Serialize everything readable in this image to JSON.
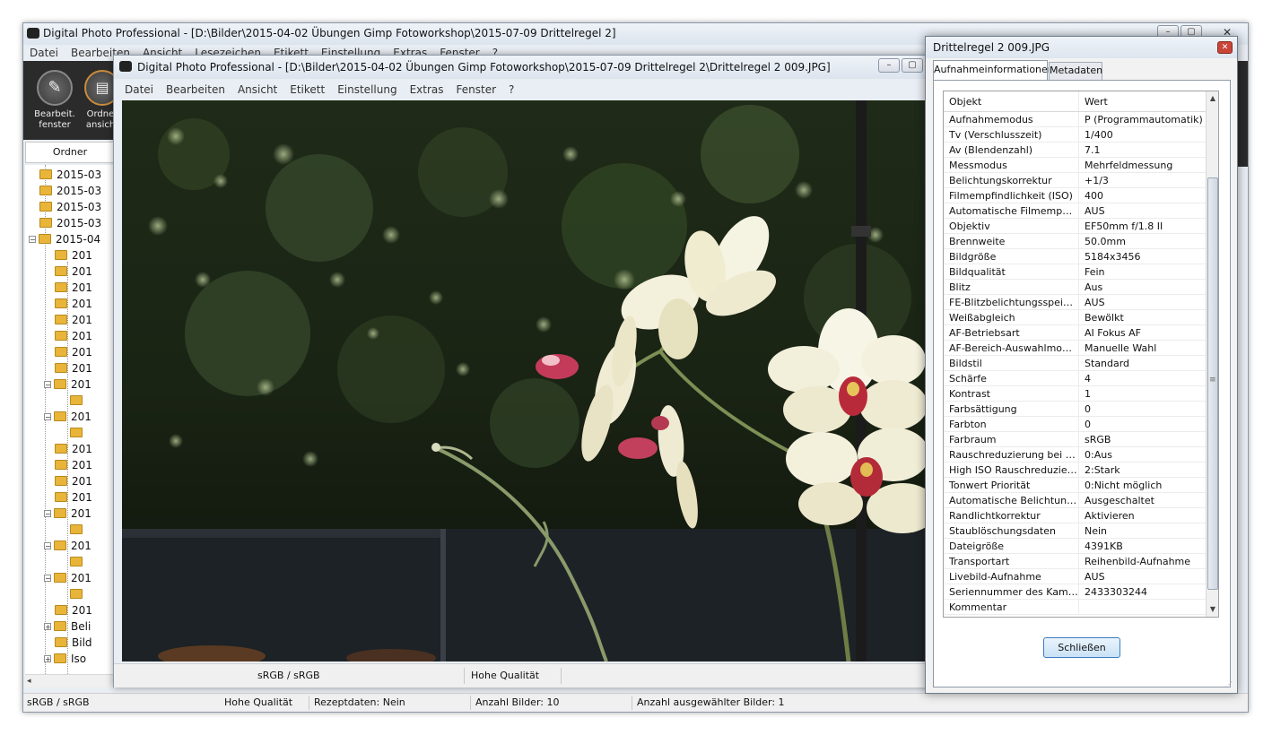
{
  "main_window": {
    "title": "Digital Photo Professional - [D:\\Bilder\\2015-04-02 Übungen  Gimp Fotoworkshop\\2015-07-09 Drittelregel 2]",
    "menu": [
      "Datei",
      "Bearbeiten",
      "Ansicht",
      "Lesezeichen",
      "Etikett",
      "Einstellung",
      "Extras",
      "Fenster",
      "?"
    ],
    "toolbar": [
      {
        "label": "Bearbeit. fenster",
        "icon": "edit-window-icon"
      },
      {
        "label": "Ordner ansicht",
        "icon": "folder-view-icon"
      }
    ],
    "folder_panel_title": "Ordner",
    "tree": [
      {
        "label": "2015-03",
        "indent": 0,
        "expander": ""
      },
      {
        "label": "2015-03",
        "indent": 0,
        "expander": ""
      },
      {
        "label": "2015-03",
        "indent": 0,
        "expander": ""
      },
      {
        "label": "2015-03",
        "indent": 0,
        "expander": ""
      },
      {
        "label": "2015-04",
        "indent": 0,
        "expander": "-"
      },
      {
        "label": "201",
        "indent": 1,
        "expander": ""
      },
      {
        "label": "201",
        "indent": 1,
        "expander": ""
      },
      {
        "label": "201",
        "indent": 1,
        "expander": ""
      },
      {
        "label": "201",
        "indent": 1,
        "expander": ""
      },
      {
        "label": "201",
        "indent": 1,
        "expander": ""
      },
      {
        "label": "201",
        "indent": 1,
        "expander": ""
      },
      {
        "label": "201",
        "indent": 1,
        "expander": ""
      },
      {
        "label": "201",
        "indent": 1,
        "expander": ""
      },
      {
        "label": "201",
        "indent": 1,
        "expander": "-"
      },
      {
        "label": "",
        "indent": 2,
        "expander": ""
      },
      {
        "label": "201",
        "indent": 1,
        "expander": "-"
      },
      {
        "label": "",
        "indent": 2,
        "expander": ""
      },
      {
        "label": "201",
        "indent": 1,
        "expander": ""
      },
      {
        "label": "201",
        "indent": 1,
        "expander": ""
      },
      {
        "label": "201",
        "indent": 1,
        "expander": ""
      },
      {
        "label": "201",
        "indent": 1,
        "expander": ""
      },
      {
        "label": "201",
        "indent": 1,
        "expander": "-"
      },
      {
        "label": "",
        "indent": 2,
        "expander": ""
      },
      {
        "label": "201",
        "indent": 1,
        "expander": "-"
      },
      {
        "label": "",
        "indent": 2,
        "expander": ""
      },
      {
        "label": "201",
        "indent": 1,
        "expander": "-"
      },
      {
        "label": "",
        "indent": 2,
        "expander": ""
      },
      {
        "label": "201",
        "indent": 1,
        "expander": ""
      },
      {
        "label": "Beli",
        "indent": 1,
        "expander": "+"
      },
      {
        "label": "Bild",
        "indent": 1,
        "expander": ""
      },
      {
        "label": "Iso",
        "indent": 1,
        "expander": "+"
      }
    ],
    "status": {
      "colorspace": "sRGB / sRGB",
      "quality": "Hohe Qualität",
      "recipe": "Rezeptdaten: Nein",
      "count": "Anzahl Bilder: 10",
      "selected": "Anzahl ausgewählter Bilder: 1"
    }
  },
  "edit_window": {
    "title": "Digital Photo Professional - [D:\\Bilder\\2015-04-02 Übungen  Gimp Fotoworkshop\\2015-07-09 Drittelregel 2\\Drittelregel 2 009.JPG]",
    "menu": [
      "Datei",
      "Bearbeiten",
      "Ansicht",
      "Etikett",
      "Einstellung",
      "Extras",
      "Fenster",
      "?"
    ],
    "status": {
      "colorspace": "sRGB / sRGB",
      "quality": "Hohe Qualität"
    }
  },
  "info_dialog": {
    "title": "Drittelregel 2 009.JPG",
    "tabs": [
      "Aufnahmeinformationen",
      "Metadaten"
    ],
    "active_tab": "Aufnahmeinformationen",
    "columns": [
      "Objekt",
      "Wert"
    ],
    "rows": [
      [
        "Aufnahmemodus",
        "P (Programmautomatik)"
      ],
      [
        "Tv (Verschlusszeit)",
        "1/400"
      ],
      [
        "Av (Blendenzahl)",
        "7.1"
      ],
      [
        "Messmodus",
        "Mehrfeldmessung"
      ],
      [
        "Belichtungskorrektur",
        "+1/3"
      ],
      [
        "Filmempfindlichkeit (ISO)",
        "400"
      ],
      [
        "Automatische Filmempfindli...",
        "AUS"
      ],
      [
        "Objektiv",
        "EF50mm f/1.8 II"
      ],
      [
        "Brennweite",
        "50.0mm"
      ],
      [
        "Bildgröße",
        "5184x3456"
      ],
      [
        "Bildqualität",
        "Fein"
      ],
      [
        "Blitz",
        "Aus"
      ],
      [
        "FE-Blitzbelichtungsspeicher...",
        "AUS"
      ],
      [
        "Weißabgleich",
        "Bewölkt"
      ],
      [
        "AF-Betriebsart",
        "AI Fokus AF"
      ],
      [
        "AF-Bereich-Auswahlmodus",
        "Manuelle  Wahl"
      ],
      [
        "Bildstil",
        "Standard"
      ],
      [
        "Schärfe",
        "4"
      ],
      [
        "Kontrast",
        "1"
      ],
      [
        "Farbsättigung",
        "0"
      ],
      [
        "Farbton",
        "0"
      ],
      [
        "Farbraum",
        "sRGB"
      ],
      [
        "Rauschreduzierung bei Lan...",
        "0:Aus"
      ],
      [
        "High ISO Rauschreduzierung",
        "2:Stark"
      ],
      [
        "Tonwert Priorität",
        "0:Nicht möglich"
      ],
      [
        "Automatische Belichtungso...",
        "Ausgeschaltet"
      ],
      [
        "Randlichtkorrektur",
        "Aktivieren"
      ],
      [
        "Staublöschungsdaten",
        "Nein"
      ],
      [
        "Dateigröße",
        "4391KB"
      ],
      [
        "Transportart",
        "Reihenbild-Aufnahme"
      ],
      [
        "Livebild-Aufnahme",
        "AUS"
      ],
      [
        "Seriennummer des Kamera...",
        "2433303244"
      ],
      [
        "Kommentar",
        ""
      ]
    ],
    "close_button": "Schließen"
  },
  "colors": {
    "dark_toolbar": "#2b2b2b",
    "title_bar": "#dfe6ef",
    "button_border": "#3d7bbf"
  }
}
